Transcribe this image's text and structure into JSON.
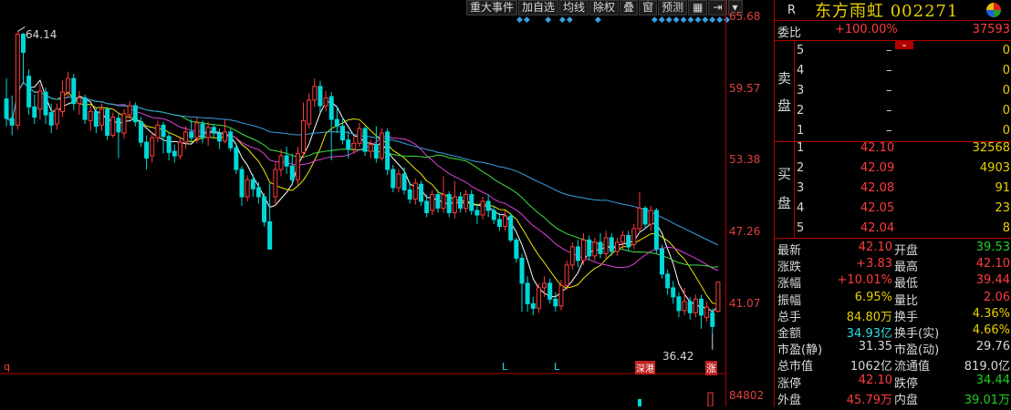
{
  "toolbar": {
    "items": [
      "重大事件",
      "加自选",
      "均线",
      "除权",
      "叠",
      "窗",
      "预测"
    ],
    "icons": [
      "grid-icon",
      "pin-icon",
      "dropdown-icon"
    ]
  },
  "price_axis": [
    "65.68",
    "59.57",
    "53.38",
    "47.26",
    "41.07",
    "84802"
  ],
  "annotations": {
    "high": "64.14",
    "low": "36.42",
    "left_marker": "q",
    "tags": [
      "L",
      "L",
      "深港",
      "涨"
    ]
  },
  "quote": {
    "r_label": "R",
    "title": "东方雨虹 002271",
    "committee_label": "委比",
    "committee_ratio": "+100.00%",
    "committee_diff": "37593",
    "sell_side_label": [
      "卖",
      "盘"
    ],
    "buy_side_label": [
      "买",
      "盘"
    ],
    "sell_levels": [
      {
        "level": "5",
        "price": "–",
        "vol": "0"
      },
      {
        "level": "4",
        "price": "–",
        "vol": "0"
      },
      {
        "level": "3",
        "price": "–",
        "vol": "0"
      },
      {
        "level": "2",
        "price": "–",
        "vol": "0"
      },
      {
        "level": "1",
        "price": "–",
        "vol": "0"
      }
    ],
    "buy_levels": [
      {
        "level": "1",
        "price": "42.10",
        "vol": "32568"
      },
      {
        "level": "2",
        "price": "42.09",
        "vol": "4903"
      },
      {
        "level": "3",
        "price": "42.08",
        "vol": "91"
      },
      {
        "level": "4",
        "price": "42.05",
        "vol": "23"
      },
      {
        "level": "5",
        "price": "42.04",
        "vol": "8"
      }
    ],
    "stats": [
      {
        "l1": "最新",
        "v1": "42.10",
        "c1": "red",
        "l2": "开盘",
        "v2": "39.53",
        "c2": "green"
      },
      {
        "l1": "涨跌",
        "v1": "+3.83",
        "c1": "red",
        "l2": "最高",
        "v2": "42.10",
        "c2": "red"
      },
      {
        "l1": "涨幅",
        "v1": "+10.01%",
        "c1": "red",
        "l2": "最低",
        "v2": "39.44",
        "c2": "red"
      },
      {
        "l1": "振幅",
        "v1": "6.95%",
        "c1": "yellow",
        "l2": "量比",
        "v2": "2.06",
        "c2": "red"
      },
      {
        "l1": "总手",
        "v1": "84.80万",
        "c1": "yellow",
        "l2": "换手",
        "v2": "4.36%",
        "c2": "yellow"
      },
      {
        "l1": "金额",
        "v1": "34.93亿",
        "c1": "cyan",
        "l2": "换手(实)",
        "v2": "4.66%",
        "c2": "yellow"
      },
      {
        "l1": "市盈(静)",
        "v1": "31.35",
        "c1": "white",
        "l2": "市盈(动)",
        "v2": "29.76",
        "c2": "white"
      },
      {
        "l1": "总市值",
        "v1": "1062亿",
        "c1": "white",
        "l2": "流通值",
        "v2": "819.0亿",
        "c2": "white"
      },
      {
        "l1": "涨停",
        "v1": "42.10",
        "c1": "red",
        "l2": "跌停",
        "v2": "34.44",
        "c2": "green"
      },
      {
        "l1": "外盘",
        "v1": "45.79万",
        "c1": "red",
        "l2": "内盘",
        "v2": "39.01万",
        "c2": "green"
      }
    ]
  },
  "colors": {
    "up": "#ff3c3c",
    "down": "#00d8d8",
    "ma5": "#ffffff",
    "ma10": "#e8e800",
    "ma20": "#e040e0",
    "ma30": "#40e040",
    "ma60": "#3aa0e0"
  },
  "chart_data": {
    "type": "candlestick",
    "ylim": [
      35.5,
      66.5
    ],
    "candles": [
      [
        58.2,
        56.5,
        60.0,
        55.8
      ],
      [
        56.5,
        55.9,
        58.5,
        55.0
      ],
      [
        55.9,
        63.9,
        64.14,
        55.5
      ],
      [
        63.9,
        62.3,
        64.0,
        59.5
      ],
      [
        60.2,
        57.5,
        60.8,
        56.8
      ],
      [
        57.5,
        56.6,
        58.6,
        56.0
      ],
      [
        57.3,
        58.9,
        59.5,
        56.4
      ],
      [
        58.8,
        56.8,
        59.2,
        56.0
      ],
      [
        57.0,
        55.9,
        57.8,
        55.2
      ],
      [
        56.0,
        57.3,
        57.8,
        55.5
      ],
      [
        57.1,
        58.8,
        59.8,
        56.6
      ],
      [
        58.8,
        60.0,
        60.6,
        58.3
      ],
      [
        60.0,
        57.8,
        60.4,
        57.2
      ],
      [
        57.8,
        58.3,
        58.9,
        56.8
      ],
      [
        58.3,
        56.4,
        58.6,
        56.0
      ],
      [
        56.3,
        57.1,
        57.6,
        55.4
      ],
      [
        57.1,
        55.8,
        57.4,
        55.2
      ],
      [
        55.9,
        57.3,
        57.8,
        55.4
      ],
      [
        57.3,
        55.0,
        57.5,
        54.6
      ],
      [
        55.0,
        56.6,
        57.0,
        54.8
      ],
      [
        56.5,
        55.3,
        56.9,
        53.0
      ],
      [
        55.2,
        56.9,
        57.3,
        54.7
      ],
      [
        56.8,
        57.6,
        58.0,
        56.4
      ],
      [
        57.6,
        56.2,
        57.9,
        55.8
      ],
      [
        56.2,
        54.4,
        56.6,
        54.0
      ],
      [
        54.4,
        53.0,
        55.0,
        52.0
      ],
      [
        53.2,
        54.8,
        55.3,
        52.6
      ],
      [
        54.8,
        55.9,
        56.3,
        54.4
      ],
      [
        55.9,
        54.9,
        56.2,
        53.4
      ],
      [
        54.9,
        53.5,
        55.3,
        52.8
      ],
      [
        53.6,
        53.2,
        54.2,
        52.6
      ],
      [
        53.2,
        54.4,
        54.9,
        52.9
      ],
      [
        54.4,
        55.3,
        55.8,
        53.8
      ],
      [
        55.3,
        54.8,
        56.4,
        54.4
      ],
      [
        54.8,
        56.1,
        56.6,
        54.3
      ],
      [
        56.0,
        54.8,
        56.3,
        54.3
      ],
      [
        54.8,
        55.7,
        56.2,
        54.1
      ],
      [
        55.7,
        55.2,
        56.0,
        54.8
      ],
      [
        55.2,
        54.5,
        55.6,
        53.8
      ],
      [
        54.5,
        55.3,
        56.4,
        54.3
      ],
      [
        55.3,
        53.9,
        55.6,
        53.6
      ],
      [
        53.9,
        52.0,
        54.3,
        51.6
      ],
      [
        52.0,
        49.6,
        52.3,
        48.8
      ],
      [
        49.6,
        51.1,
        51.5,
        49.2
      ],
      [
        51.1,
        50.3,
        51.6,
        49.6
      ],
      [
        50.4,
        49.6,
        50.9,
        49.0
      ],
      [
        49.6,
        47.4,
        49.9,
        47.0
      ],
      [
        47.4,
        45.0,
        50.8,
        45.0
      ],
      [
        49.6,
        52.0,
        52.6,
        48.8
      ],
      [
        52.0,
        53.2,
        53.8,
        51.4
      ],
      [
        53.2,
        52.3,
        54.0,
        51.6
      ],
      [
        52.3,
        51.1,
        53.4,
        50.6
      ],
      [
        51.1,
        53.4,
        54.0,
        50.6
      ],
      [
        53.5,
        56.3,
        57.9,
        53.0
      ],
      [
        56.0,
        58.1,
        58.7,
        55.6
      ],
      [
        58.1,
        59.3,
        60.0,
        57.5
      ],
      [
        59.3,
        57.6,
        59.8,
        57.0
      ],
      [
        57.6,
        58.3,
        58.9,
        57.1
      ],
      [
        58.4,
        56.4,
        58.8,
        52.8
      ],
      [
        56.4,
        55.8,
        57.6,
        55.2
      ],
      [
        55.8,
        54.6,
        56.6,
        54.2
      ],
      [
        54.6,
        53.8,
        55.4,
        53.0
      ],
      [
        53.8,
        54.3,
        54.9,
        53.4
      ],
      [
        54.3,
        55.6,
        56.1,
        54.0
      ],
      [
        55.6,
        53.6,
        55.8,
        53.2
      ],
      [
        53.6,
        54.2,
        54.6,
        53.0
      ],
      [
        54.2,
        53.0,
        55.8,
        52.6
      ],
      [
        53.0,
        55.2,
        55.6,
        52.8
      ],
      [
        55.3,
        52.0,
        55.6,
        51.5
      ],
      [
        52.0,
        50.4,
        52.4,
        50.0
      ],
      [
        50.4,
        51.6,
        52.0,
        50.0
      ],
      [
        51.6,
        50.2,
        52.2,
        49.8
      ],
      [
        50.2,
        49.4,
        50.9,
        49.0
      ],
      [
        49.4,
        50.8,
        51.2,
        48.9
      ],
      [
        50.7,
        49.2,
        51.0,
        48.8
      ],
      [
        49.2,
        48.2,
        49.8,
        47.8
      ],
      [
        48.4,
        49.8,
        50.2,
        48.0
      ],
      [
        49.8,
        48.6,
        50.2,
        48.2
      ],
      [
        48.6,
        49.8,
        51.4,
        48.2
      ],
      [
        49.8,
        48.2,
        50.1,
        47.8
      ],
      [
        48.2,
        49.6,
        51.0,
        47.7
      ],
      [
        49.6,
        48.6,
        50.0,
        48.2
      ],
      [
        48.6,
        49.8,
        50.2,
        48.2
      ],
      [
        49.8,
        48.4,
        50.2,
        48.0
      ],
      [
        48.4,
        48.0,
        49.0,
        47.2
      ],
      [
        48.0,
        49.2,
        49.6,
        47.6
      ],
      [
        49.2,
        48.4,
        49.8,
        47.8
      ],
      [
        48.4,
        47.6,
        48.8,
        47.2
      ],
      [
        47.6,
        47.0,
        48.2,
        46.6
      ],
      [
        47.0,
        47.9,
        48.4,
        46.6
      ],
      [
        47.9,
        45.8,
        48.2,
        45.6
      ],
      [
        45.8,
        44.2,
        46.0,
        43.8
      ],
      [
        44.2,
        42.0,
        44.6,
        39.5
      ],
      [
        42.0,
        40.2,
        42.6,
        39.5
      ],
      [
        40.2,
        39.8,
        40.8,
        39.2
      ],
      [
        39.8,
        41.6,
        42.0,
        39.4
      ],
      [
        41.6,
        42.0,
        42.6,
        40.8
      ],
      [
        42.0,
        40.6,
        42.4,
        40.2
      ],
      [
        40.6,
        40.0,
        41.2,
        39.5
      ],
      [
        40.0,
        41.8,
        42.3,
        39.6
      ],
      [
        41.8,
        43.6,
        44.0,
        41.4
      ],
      [
        43.6,
        45.2,
        45.6,
        43.2
      ],
      [
        45.2,
        44.0,
        45.8,
        43.4
      ],
      [
        44.0,
        45.8,
        46.4,
        43.6
      ],
      [
        45.8,
        44.4,
        46.2,
        44.0
      ],
      [
        44.4,
        45.6,
        46.0,
        44.0
      ],
      [
        45.6,
        44.6,
        46.4,
        44.2
      ],
      [
        44.6,
        46.0,
        46.6,
        44.2
      ],
      [
        46.0,
        44.8,
        46.4,
        44.4
      ],
      [
        44.8,
        45.6,
        46.0,
        44.4
      ],
      [
        45.6,
        46.2,
        46.6,
        45.0
      ],
      [
        46.2,
        45.2,
        46.6,
        44.8
      ],
      [
        45.4,
        46.8,
        47.2,
        45.0
      ],
      [
        46.8,
        48.6,
        50.0,
        46.4
      ],
      [
        48.6,
        47.2,
        48.8,
        46.8
      ],
      [
        47.2,
        48.4,
        48.8,
        46.6
      ],
      [
        48.4,
        45.0,
        48.6,
        44.6
      ],
      [
        45.0,
        42.8,
        45.4,
        42.4
      ],
      [
        42.8,
        41.6,
        43.2,
        41.0
      ],
      [
        41.6,
        40.8,
        42.2,
        40.2
      ],
      [
        40.8,
        39.6,
        41.2,
        39.0
      ],
      [
        39.6,
        40.4,
        41.6,
        39.2
      ],
      [
        40.4,
        39.4,
        40.8,
        38.8
      ],
      [
        39.4,
        40.6,
        41.0,
        39.0
      ],
      [
        40.6,
        39.2,
        41.0,
        38.0
      ],
      [
        39.0,
        39.9,
        40.4,
        38.6
      ],
      [
        39.4,
        38.2,
        39.8,
        37.6
      ],
      [
        39.53,
        42.1,
        42.1,
        39.44
      ]
    ]
  }
}
